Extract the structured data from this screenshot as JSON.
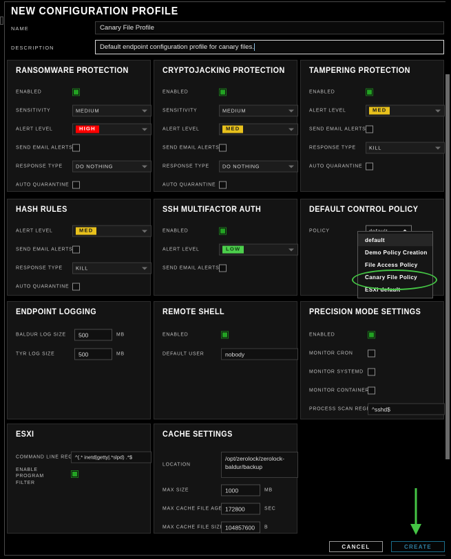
{
  "dialog": {
    "title": "NEW CONFIGURATION PROFILE",
    "name_label": "NAME",
    "name_value": "Canary File Profile",
    "description_label": "DESCRIPTION",
    "description_value": "Default endpoint configuration profile for canary files."
  },
  "panels": {
    "ransomware": {
      "title": "RANSOMWARE PROTECTION",
      "enabled_label": "ENABLED",
      "enabled_checked": true,
      "sensitivity_label": "SENSITIVITY",
      "sensitivity_value": "MEDIUM",
      "alert_level_label": "ALERT LEVEL",
      "alert_level_value": "HIGH",
      "send_email_label": "SEND EMAIL ALERTS",
      "send_email_checked": false,
      "response_type_label": "RESPONSE TYPE",
      "response_type_value": "DO NOTHING",
      "auto_quarantine_label": "AUTO QUARANTINE",
      "auto_quarantine_checked": false
    },
    "cryptojacking": {
      "title": "CRYPTOJACKING PROTECTION",
      "enabled_label": "ENABLED",
      "enabled_checked": true,
      "sensitivity_label": "SENSITIVITY",
      "sensitivity_value": "MEDIUM",
      "alert_level_label": "ALERT LEVEL",
      "alert_level_value": "MED",
      "send_email_label": "SEND EMAIL ALERTS",
      "send_email_checked": false,
      "response_type_label": "RESPONSE TYPE",
      "response_type_value": "DO NOTHING",
      "auto_quarantine_label": "AUTO QUARANTINE",
      "auto_quarantine_checked": false
    },
    "tampering": {
      "title": "TAMPERING PROTECTION",
      "enabled_label": "ENABLED",
      "enabled_checked": true,
      "alert_level_label": "ALERT LEVEL",
      "alert_level_value": "MED",
      "send_email_label": "SEND EMAIL ALERTS",
      "send_email_checked": false,
      "response_type_label": "RESPONSE TYPE",
      "response_type_value": "KILL",
      "auto_quarantine_label": "AUTO QUARANTINE",
      "auto_quarantine_checked": false
    },
    "hash_rules": {
      "title": "HASH RULES",
      "alert_level_label": "ALERT LEVEL",
      "alert_level_value": "MED",
      "send_email_label": "SEND EMAIL ALERTS",
      "send_email_checked": false,
      "response_type_label": "RESPONSE TYPE",
      "response_type_value": "KILL",
      "auto_quarantine_label": "AUTO QUARANTINE",
      "auto_quarantine_checked": false
    },
    "ssh_mfa": {
      "title": "SSH MULTIFACTOR AUTH",
      "enabled_label": "ENABLED",
      "enabled_checked": true,
      "alert_level_label": "ALERT LEVEL",
      "alert_level_value": "LOW",
      "send_email_label": "SEND EMAIL ALERTS",
      "send_email_checked": false
    },
    "control_policy": {
      "title": "DEFAULT CONTROL POLICY",
      "policy_label": "POLICY",
      "policy_value": "default",
      "options": [
        "default",
        "Demo Policy Creation",
        "File Access Policy",
        "Canary File Policy",
        "ESXi default"
      ],
      "highlighted_option": "Canary File Policy",
      "highlight_color": "#45c545"
    },
    "endpoint_logging": {
      "title": "ENDPOINT LOGGING",
      "baldur_label": "BALDUR LOG SIZE",
      "baldur_value": "500",
      "baldur_unit": "MB",
      "tyr_label": "TYR LOG SIZE",
      "tyr_value": "500",
      "tyr_unit": "MB"
    },
    "remote_shell": {
      "title": "REMOTE SHELL",
      "enabled_label": "ENABLED",
      "enabled_checked": true,
      "default_user_label": "DEFAULT USER",
      "default_user_value": "nobody"
    },
    "precision_mode": {
      "title": "PRECISION MODE SETTINGS",
      "enabled_label": "ENABLED",
      "enabled_checked": true,
      "monitor_cron_label": "MONITOR CRON",
      "monitor_cron_checked": false,
      "monitor_systemd_label": "MONITOR SYSTEMD",
      "monitor_systemd_checked": false,
      "monitor_containerd_label": "MONITOR CONTAINERD",
      "monitor_containerd_checked": false,
      "process_scan_label": "PROCESS SCAN REGEX",
      "process_scan_value": "^sshd$"
    },
    "esxi": {
      "title": "ESXI",
      "cmdline_label": "COMMAND LINE REGEX",
      "cmdline_value": "^(.* inetd|getty|.*slpd) .*$",
      "program_filter_label": "ENABLE PROGRAM FILTER",
      "program_filter_checked": true
    },
    "cache": {
      "title": "CACHE SETTINGS",
      "location_label": "LOCATION",
      "location_value": "/opt/zerolock/zerolock-baldur/backup",
      "max_size_label": "MAX SIZE",
      "max_size_value": "1000",
      "max_size_unit": "MB",
      "max_age_label": "MAX CACHE FILE AGE",
      "max_age_value": "172800",
      "max_age_unit": "SEC",
      "max_file_size_label": "MAX CACHE FILE SIZE",
      "max_file_size_value": "104857600",
      "max_file_size_unit": "B"
    }
  },
  "footer": {
    "cancel_label": "CANCEL",
    "create_label": "CREATE"
  }
}
